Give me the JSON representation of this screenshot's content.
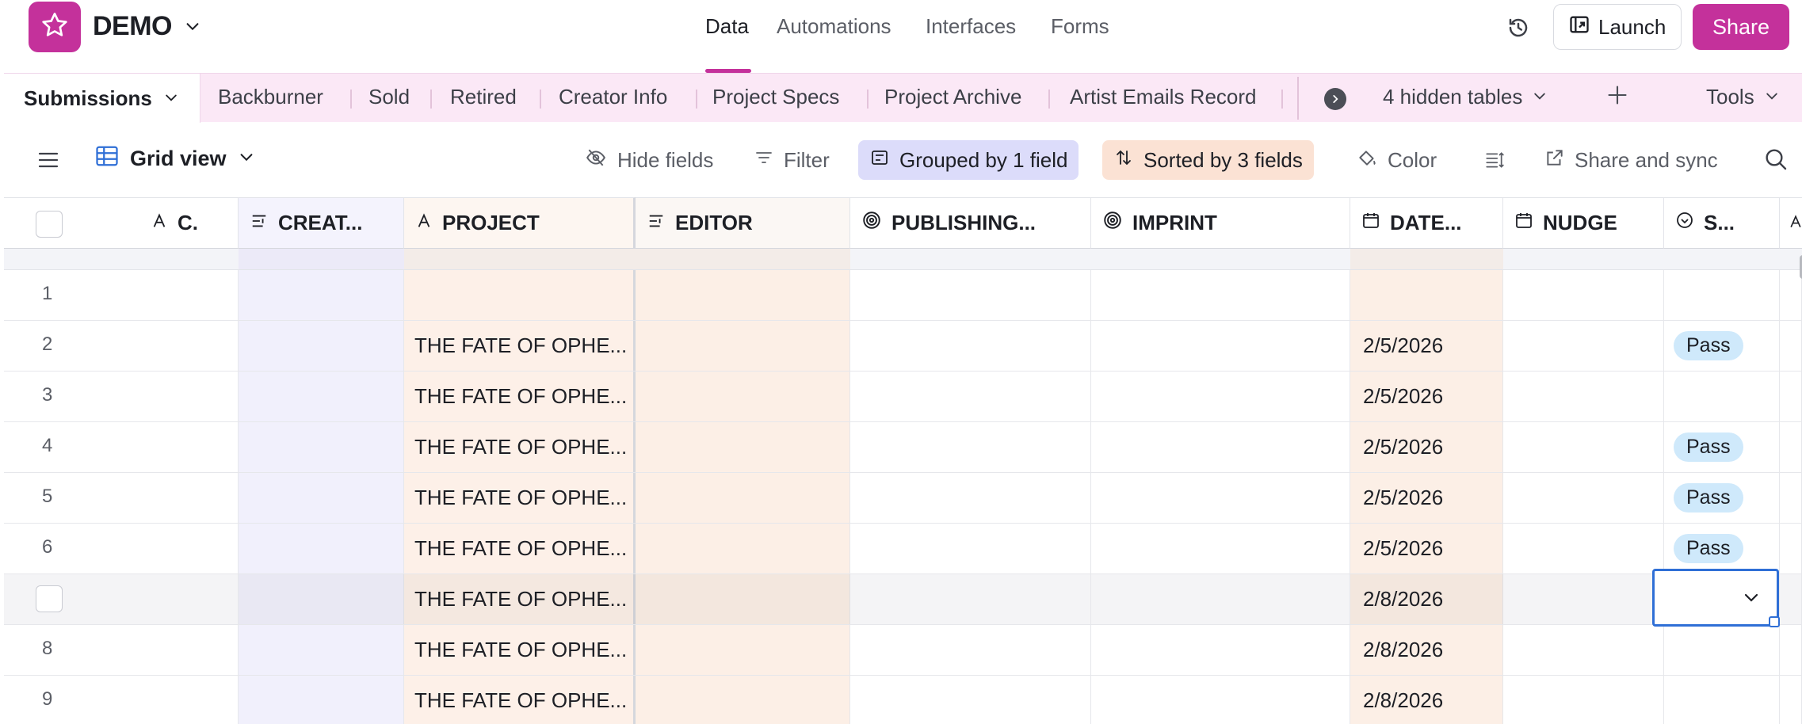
{
  "app": {
    "name": "DEMO",
    "brand_color": "#c4319b",
    "logo_icon": "star-icon"
  },
  "main_tabs": [
    {
      "label": "Data",
      "active": true
    },
    {
      "label": "Automations",
      "active": false
    },
    {
      "label": "Interfaces",
      "active": false
    },
    {
      "label": "Forms",
      "active": false
    }
  ],
  "top_actions": {
    "launch_label": "Launch",
    "share_label": "Share"
  },
  "table_tabs": {
    "active": "Submissions",
    "others": [
      "Backburner",
      "Sold",
      "Retired",
      "Creator Info",
      "Project Specs",
      "Project Archive",
      "Artist Emails Record"
    ],
    "hidden_label": "4 hidden tables",
    "tools_label": "Tools"
  },
  "view_bar": {
    "view_name": "Grid view",
    "hide_fields": "Hide fields",
    "filter": "Filter",
    "grouped": "Grouped by 1 field",
    "sorted": "Sorted by 3 fields",
    "color": "Color",
    "share_sync": "Share and sync"
  },
  "columns": [
    "C.",
    "CREAT...",
    "PROJECT",
    "EDITOR",
    "PUBLISHING...",
    "IMPRINT",
    "DATE...",
    "NUDGE",
    "S..."
  ],
  "rows": [
    {
      "num": "1",
      "project": "",
      "date": "",
      "status": ""
    },
    {
      "num": "2",
      "project": "THE FATE OF OPHE...",
      "date": "2/5/2026",
      "status": "Pass"
    },
    {
      "num": "3",
      "project": "THE FATE OF OPHE...",
      "date": "2/5/2026",
      "status": ""
    },
    {
      "num": "4",
      "project": "THE FATE OF OPHE...",
      "date": "2/5/2026",
      "status": "Pass"
    },
    {
      "num": "5",
      "project": "THE FATE OF OPHE...",
      "date": "2/5/2026",
      "status": "Pass"
    },
    {
      "num": "6",
      "project": "THE FATE OF OPHE...",
      "date": "2/5/2026",
      "status": "Pass"
    },
    {
      "num": "",
      "project": "THE FATE OF OPHE...",
      "date": "2/8/2026",
      "status": ""
    },
    {
      "num": "8",
      "project": "THE FATE OF OPHE...",
      "date": "2/8/2026",
      "status": ""
    },
    {
      "num": "9",
      "project": "THE FATE OF OPHE...",
      "date": "2/8/2026",
      "status": ""
    }
  ]
}
